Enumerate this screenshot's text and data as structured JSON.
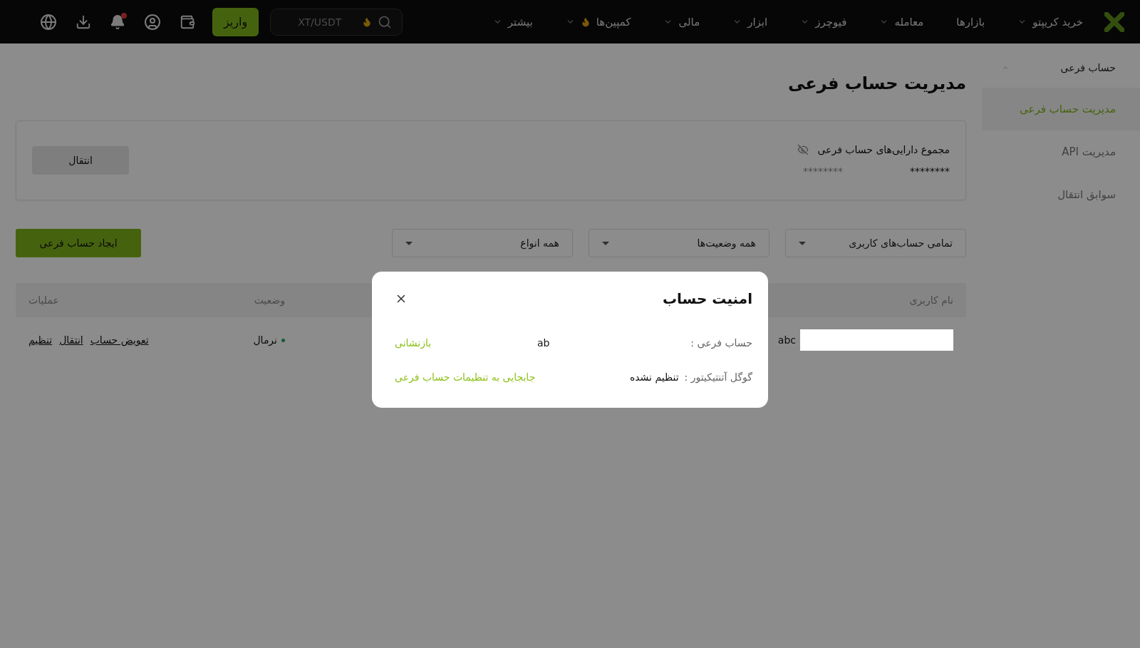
{
  "nav": {
    "items": [
      {
        "label": "خرید کریپتو",
        "caret": true,
        "hot": false
      },
      {
        "label": "بازارها",
        "caret": false,
        "hot": false
      },
      {
        "label": "معامله",
        "caret": true,
        "hot": false
      },
      {
        "label": "فیوچرز",
        "caret": true,
        "hot": false
      },
      {
        "label": "ابزار",
        "caret": true,
        "hot": false
      },
      {
        "label": "مالی",
        "caret": true,
        "hot": false
      },
      {
        "label": "کمپین‌ها",
        "caret": true,
        "hot": true
      },
      {
        "label": "بیشتر",
        "caret": true,
        "hot": false
      }
    ],
    "search": {
      "placeholder": "XT/USDT"
    },
    "deposit": "واریز",
    "notification_dot": true
  },
  "sidebar": {
    "title": "حساب فرعی",
    "expanded": true,
    "items": [
      {
        "label": "مدیریت حساب فرعی",
        "selected": true
      },
      {
        "label": "مدیریت API",
        "selected": false
      },
      {
        "label": "سوابق انتقال",
        "selected": false
      }
    ]
  },
  "page_title": "مدیریت حساب فرعی",
  "assets": {
    "title": "مجموع دارایی‌های حساب فرعی",
    "value_1": "********",
    "value_2": "********",
    "transfer": "انتقال"
  },
  "filters": [
    {
      "value": "تمامی حساب‌های کاربری"
    },
    {
      "value": "همه وضعیت‌ها"
    },
    {
      "value": "همه انواع"
    }
  ],
  "create_button": "ایجاد حساب فرعی",
  "table": {
    "columns": [
      "نام کاربری",
      "وضعیت",
      "عملیات"
    ],
    "rows": [
      {
        "username": "abc",
        "status": "نرمال",
        "color": "#155b39",
        "actions": [
          "تعویض حساب",
          "انتقال",
          "تنظیم"
        ]
      }
    ]
  },
  "modal": {
    "title": "امنیت حساب",
    "rows": [
      {
        "label": "حساب فرعی :",
        "value": "ab",
        "link": "بازنشانی"
      },
      {
        "label": "گوگل آتنتیکیتور :",
        "value": "تنظیم نشده",
        "link": "جابجایی به تنظیمات حساب فرعی"
      }
    ]
  }
}
